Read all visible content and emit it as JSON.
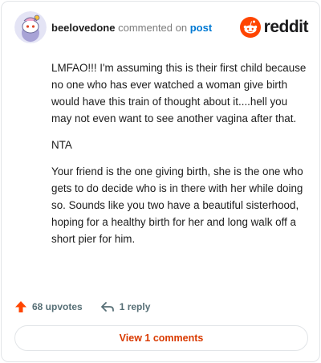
{
  "header": {
    "username": "beelovedone",
    "verb": "commented on",
    "target": "post",
    "brand": "reddit"
  },
  "comment": {
    "paragraphs": [
      "LMFAO!!! I'm assuming this is their first child because no one who has ever watched a woman give birth would have this train of thought about it....hell you may not even want to see another vagina after that.",
      "NTA",
      "Your friend is the one giving birth, she is the one who gets to do decide who is in there with her while doing so. Sounds like you two have a beautiful sisterhood, hoping for a healthy birth for her and long walk off a short pier for him."
    ]
  },
  "actions": {
    "upvotes": "68 upvotes",
    "replies": "1 reply"
  },
  "footer": {
    "view_comments": "View 1 comments"
  },
  "colors": {
    "accent": "#ff4500",
    "link": "#0079d3",
    "button_text": "#d93a00",
    "muted": "#576f76"
  },
  "icons": {
    "avatar": "snoo-avatar",
    "logo": "reddit-snoo-logo-icon",
    "upvote": "upvote-arrow-icon",
    "reply": "reply-arrow-icon"
  }
}
